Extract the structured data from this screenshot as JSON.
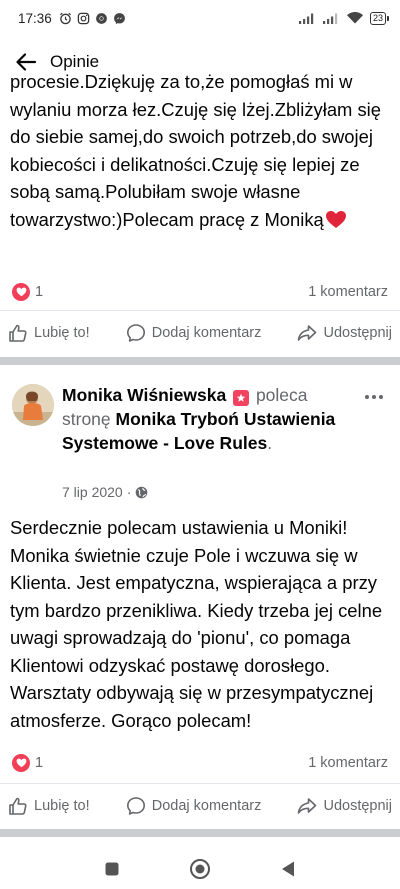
{
  "status_bar": {
    "time": "17:36",
    "battery": "23"
  },
  "header": {
    "title": "Opinie"
  },
  "review1": {
    "text": "procesie.Dziękuję za to,że pomogłaś mi w wylaniu morza łez.Czuję się lżej.Zbliżyłam się do siebie samej,do swoich potrzeb,do swojej kobiecości i delikatności.Czuję się lepiej ze sobą samą.Polubiłam swoje własne towarzystwo:)Polecam pracę z Moniką",
    "reactions": "1",
    "comments": "1 komentarz"
  },
  "actions": {
    "like": "Lubię to!",
    "comment": "Dodaj komentarz",
    "share": "Udostępnij"
  },
  "review2": {
    "author": "Monika Wiśniewska",
    "recommends": "poleca",
    "page_prefix": "stronę",
    "page_name": "Monika Tryboń Ustawienia Systemowe - Love Rules",
    "date": "7 lip 2020",
    "dot": "·",
    "text": "Serdecznie polecam ustawienia u Moniki! Monika świetnie czuje Pole i wczuwa się w Klienta. Jest empatyczna, wspierająca a przy tym bardzo przenikliwa. Kiedy trzeba jej celne uwagi sprowadzają do 'pionu', co pomaga Klientowi odzyskać postawę dorosłego. Warsztaty odbywają się w przesympatycznej atmosferze. Gorąco polecam!",
    "reactions": "1",
    "comments": "1 komentarz"
  },
  "colors": {
    "heart": "#f33e58",
    "badge": "#f3425f",
    "muted": "#65676b",
    "separator": "#c9ccd1"
  }
}
